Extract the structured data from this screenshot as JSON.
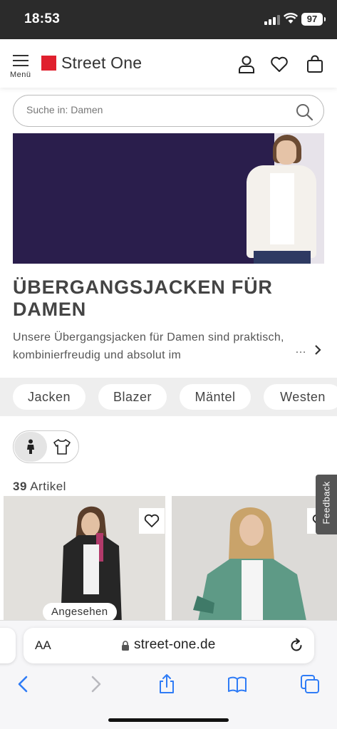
{
  "status_bar": {
    "time": "18:53",
    "battery": "97"
  },
  "header": {
    "menu_label": "Menü",
    "brand": "Street One"
  },
  "search": {
    "placeholder": "Suche in: Damen"
  },
  "category": {
    "title": "ÜBERGANGSJACKEN FÜR DAMEN",
    "description": "Unsere Übergangsjacken für Damen sind praktisch, kombinierfreudig und absolut im",
    "more": "…"
  },
  "chips": [
    "Jacken",
    "Blazer",
    "Mäntel",
    "Westen"
  ],
  "results": {
    "count": "39",
    "label": "Artikel"
  },
  "products": [
    {
      "badge": "Angesehen"
    }
  ],
  "feedback_label": "Feedback",
  "browser": {
    "text_size": "AA",
    "url": "street-one.de"
  },
  "colors": {
    "brand_red": "#e0202e",
    "ios_blue": "#2f7cf6",
    "banner_bg": "#2a1e4c"
  }
}
